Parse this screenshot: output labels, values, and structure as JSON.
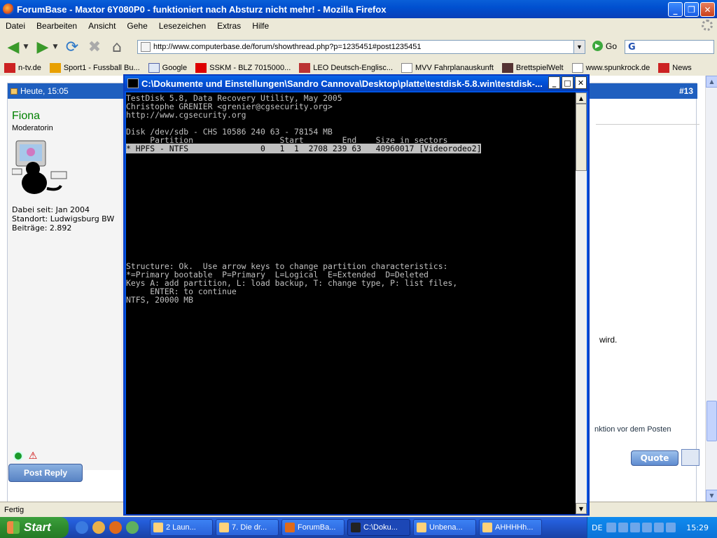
{
  "browser": {
    "title": "ForumBase - Maxtor 6Y080P0 - funktioniert nach Absturz nicht mehr! - Mozilla Firefox",
    "menu": [
      "Datei",
      "Bearbeiten",
      "Ansicht",
      "Gehe",
      "Lesezeichen",
      "Extras",
      "Hilfe"
    ],
    "url": "http://www.computerbase.de/forum/showthread.php?p=1235451#post1235451",
    "go_label": "Go",
    "search_label": "G",
    "bookmarks": [
      "n-tv.de",
      "Sport1 - Fussball Bu...",
      "Google",
      "SSKM - BLZ 7015000...",
      "LEO Deutsch-Englisc...",
      "MVV Fahrplanauskunft",
      "BrettspielWelt",
      "www.spunkrock.de",
      "News"
    ],
    "status": "Fertig"
  },
  "post": {
    "date": "Heute, 15:05",
    "number": "#13",
    "username": "Fiona",
    "role": "Moderatorin",
    "joined": "Dabei seit: Jan 2004",
    "location": "Standort: Ludwigsburg BW",
    "posts": "Beiträge: 2.892",
    "visible_text_1": "wird.",
    "visible_text_2": "nktion vor dem Posten",
    "quote_label": "Quote",
    "reply_label": "Post Reply"
  },
  "console": {
    "title": "C:\\Dokumente und Einstellungen\\Sandro Cannova\\Desktop\\platte\\testdisk-5.8.win\\testdisk-...",
    "line1": "TestDisk 5.8, Data Recovery Utility, May 2005",
    "line2": "Christophe GRENIER <grenier@cgsecurity.org>",
    "line3": "http://www.cgsecurity.org",
    "line4": "Disk /dev/sdb - CHS 10586 240 63 - 78154 MB",
    "line5": "     Partition                  Start        End    Size in sectors",
    "line6": "* HPFS - NTFS               0   1  1  2708 239 63   40960017 [Videorodeo2]",
    "line7": "Structure: Ok.  Use arrow keys to change partition characteristics:",
    "line8": "*=Primary bootable  P=Primary  L=Logical  E=Extended  D=Deleted",
    "line9": "Keys A: add partition, L: load backup, T: change type, P: list files,",
    "line10": "     ENTER: to continue",
    "line11": "NTFS, 20000 MB"
  },
  "taskbar": {
    "start": "Start",
    "tasks": [
      "2 Laun...",
      "7. Die dr...",
      "ForumBa...",
      "C:\\Doku...",
      "Unbena...",
      "AHHHHh..."
    ],
    "lang": "DE",
    "clock": "15:29"
  }
}
